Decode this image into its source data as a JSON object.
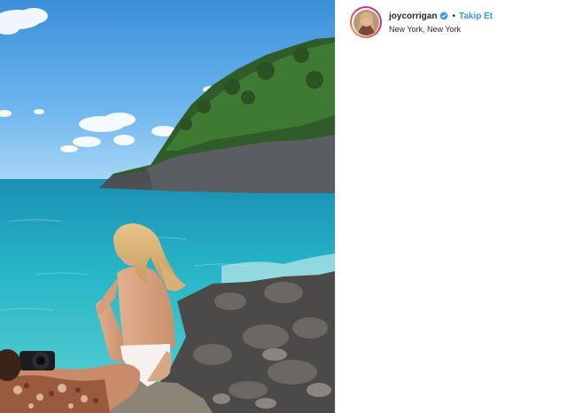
{
  "header": {
    "username": "joycorrigan",
    "separator": "•",
    "follow_label": "Takip Et",
    "location": "New York, New York",
    "verified_icon": "verified-badge-icon"
  },
  "colors": {
    "follow_blue": "#3897f0",
    "username_text": "#262626",
    "verified_blue": "#3897f0"
  }
}
